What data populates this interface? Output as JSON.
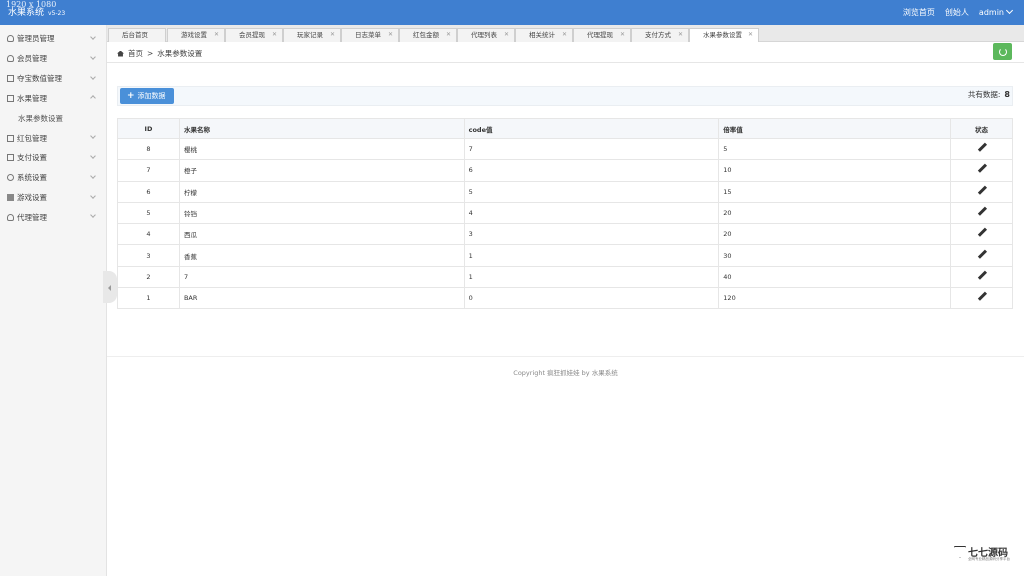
{
  "topbar": {
    "resolution": "1920 x 1080",
    "brand": "水果系统",
    "version": "v5-23",
    "links": [
      "浏览首页",
      "创始人",
      "admin"
    ]
  },
  "sidebar": {
    "items": [
      {
        "label": "管理员管理",
        "icon": "user-icon",
        "expanded": false
      },
      {
        "label": "会员管理",
        "icon": "user-icon",
        "expanded": false
      },
      {
        "label": "夺宝数值管理",
        "icon": "grid-icon",
        "expanded": false
      },
      {
        "label": "水果管理",
        "icon": "doc-icon",
        "expanded": true
      },
      {
        "label": "红包管理",
        "icon": "doc-icon",
        "expanded": false
      },
      {
        "label": "支付设置",
        "icon": "doc-icon",
        "expanded": false
      },
      {
        "label": "系统设置",
        "icon": "gear-icon",
        "expanded": false
      },
      {
        "label": "游戏设置",
        "icon": "cube-icon",
        "expanded": false
      },
      {
        "label": "代理管理",
        "icon": "user-icon",
        "expanded": false
      }
    ],
    "submenu": {
      "parent_index": 3,
      "label": "水果参数设置"
    }
  },
  "tabs": [
    "后台首页",
    "游戏设置",
    "会员提现",
    "玩家记录",
    "日志菜单",
    "红包金额",
    "代理列表",
    "相关统计",
    "代理提现",
    "支付方式",
    "水果参数设置"
  ],
  "active_tab": "水果参数设置",
  "breadcrumb": {
    "home": "首页",
    "separator": ">",
    "current": "水果参数设置"
  },
  "toolbar": {
    "add_label": "添加数据",
    "total_label": "共有数据:",
    "total_count": "8"
  },
  "table": {
    "headers": [
      "ID",
      "水果名称",
      "code值",
      "倍率值",
      "状态"
    ],
    "rows": [
      [
        "8",
        "樱桃",
        "7",
        "5"
      ],
      [
        "7",
        "橙子",
        "6",
        "10"
      ],
      [
        "6",
        "柠檬",
        "5",
        "15"
      ],
      [
        "5",
        "铃铛",
        "4",
        "20"
      ],
      [
        "4",
        "西瓜",
        "3",
        "20"
      ],
      [
        "3",
        "香蕉",
        "1",
        "30"
      ],
      [
        "2",
        "7",
        "1",
        "40"
      ],
      [
        "1",
        "BAR",
        "0",
        "120"
      ]
    ]
  },
  "footer": {
    "copyright": "Copyright 疯狂抓娃娃 by 水果系统"
  },
  "watermark": {
    "text": "七七源码",
    "sub": "全网专业精品源码分享平台"
  },
  "colors": {
    "topbar": "#3f7fd0",
    "primary_button": "#4a90d9",
    "refresh_button": "#5cb85c"
  }
}
